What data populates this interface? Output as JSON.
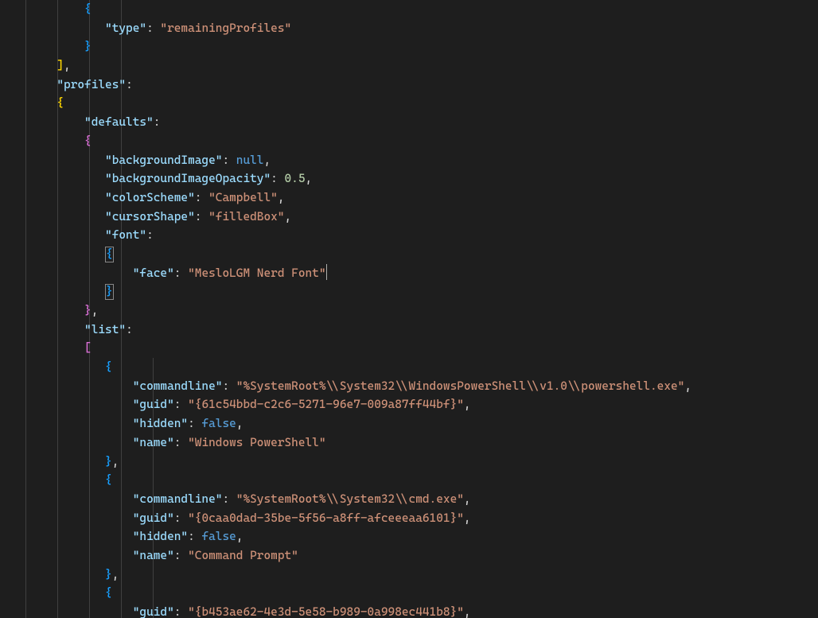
{
  "tokens": {
    "t_type": "\"type\"",
    "t_remaining": "\"remainingProfiles\"",
    "t_profiles": "\"profiles\"",
    "t_defaults": "\"defaults\"",
    "t_backgroundImage": "\"backgroundImage\"",
    "t_null": "null",
    "t_backgroundImageOpacity": "\"backgroundImageOpacity\"",
    "t_opacity_val": "0.5",
    "t_colorScheme": "\"colorScheme\"",
    "t_campbell": "\"Campbell\"",
    "t_cursorShape": "\"cursorShape\"",
    "t_filledBox": "\"filledBox\"",
    "t_font": "\"font\"",
    "t_face": "\"face\"",
    "t_meslo": "\"MesloLGM Nerd Font\"",
    "t_list": "\"list\"",
    "t_commandline": "\"commandline\"",
    "t_guid": "\"guid\"",
    "t_hidden": "\"hidden\"",
    "t_false": "false",
    "t_name": "\"name\"",
    "t_ps_cmd": "\"%SystemRoot%\\\\System32\\\\WindowsPowerShell\\\\v1.0\\\\powershell.exe\"",
    "t_ps_guid": "\"{61c54bbd-c2c6-5271-96e7-009a87ff44bf}\"",
    "t_ps_name": "\"Windows PowerShell\"",
    "t_cmd_cmd": "\"%SystemRoot%\\\\System32\\\\cmd.exe\"",
    "t_cmd_guid": "\"{0caa0dad-35be-5f56-a8ff-afceeeaa6101}\"",
    "t_cmd_name": "\"Command Prompt\"",
    "t_azure_guid": "\"{b453ae62-4e3d-5e58-b989-0a998ec441b8}\""
  },
  "colors": {
    "background": "#1e1e1e",
    "property": "#9cdcfe",
    "string": "#ce9178",
    "number": "#b5cea8",
    "constant": "#569cd6",
    "bracket_pink": "#da70d6",
    "bracket_yellow": "#ffd700",
    "bracket_blue": "#179fff"
  }
}
